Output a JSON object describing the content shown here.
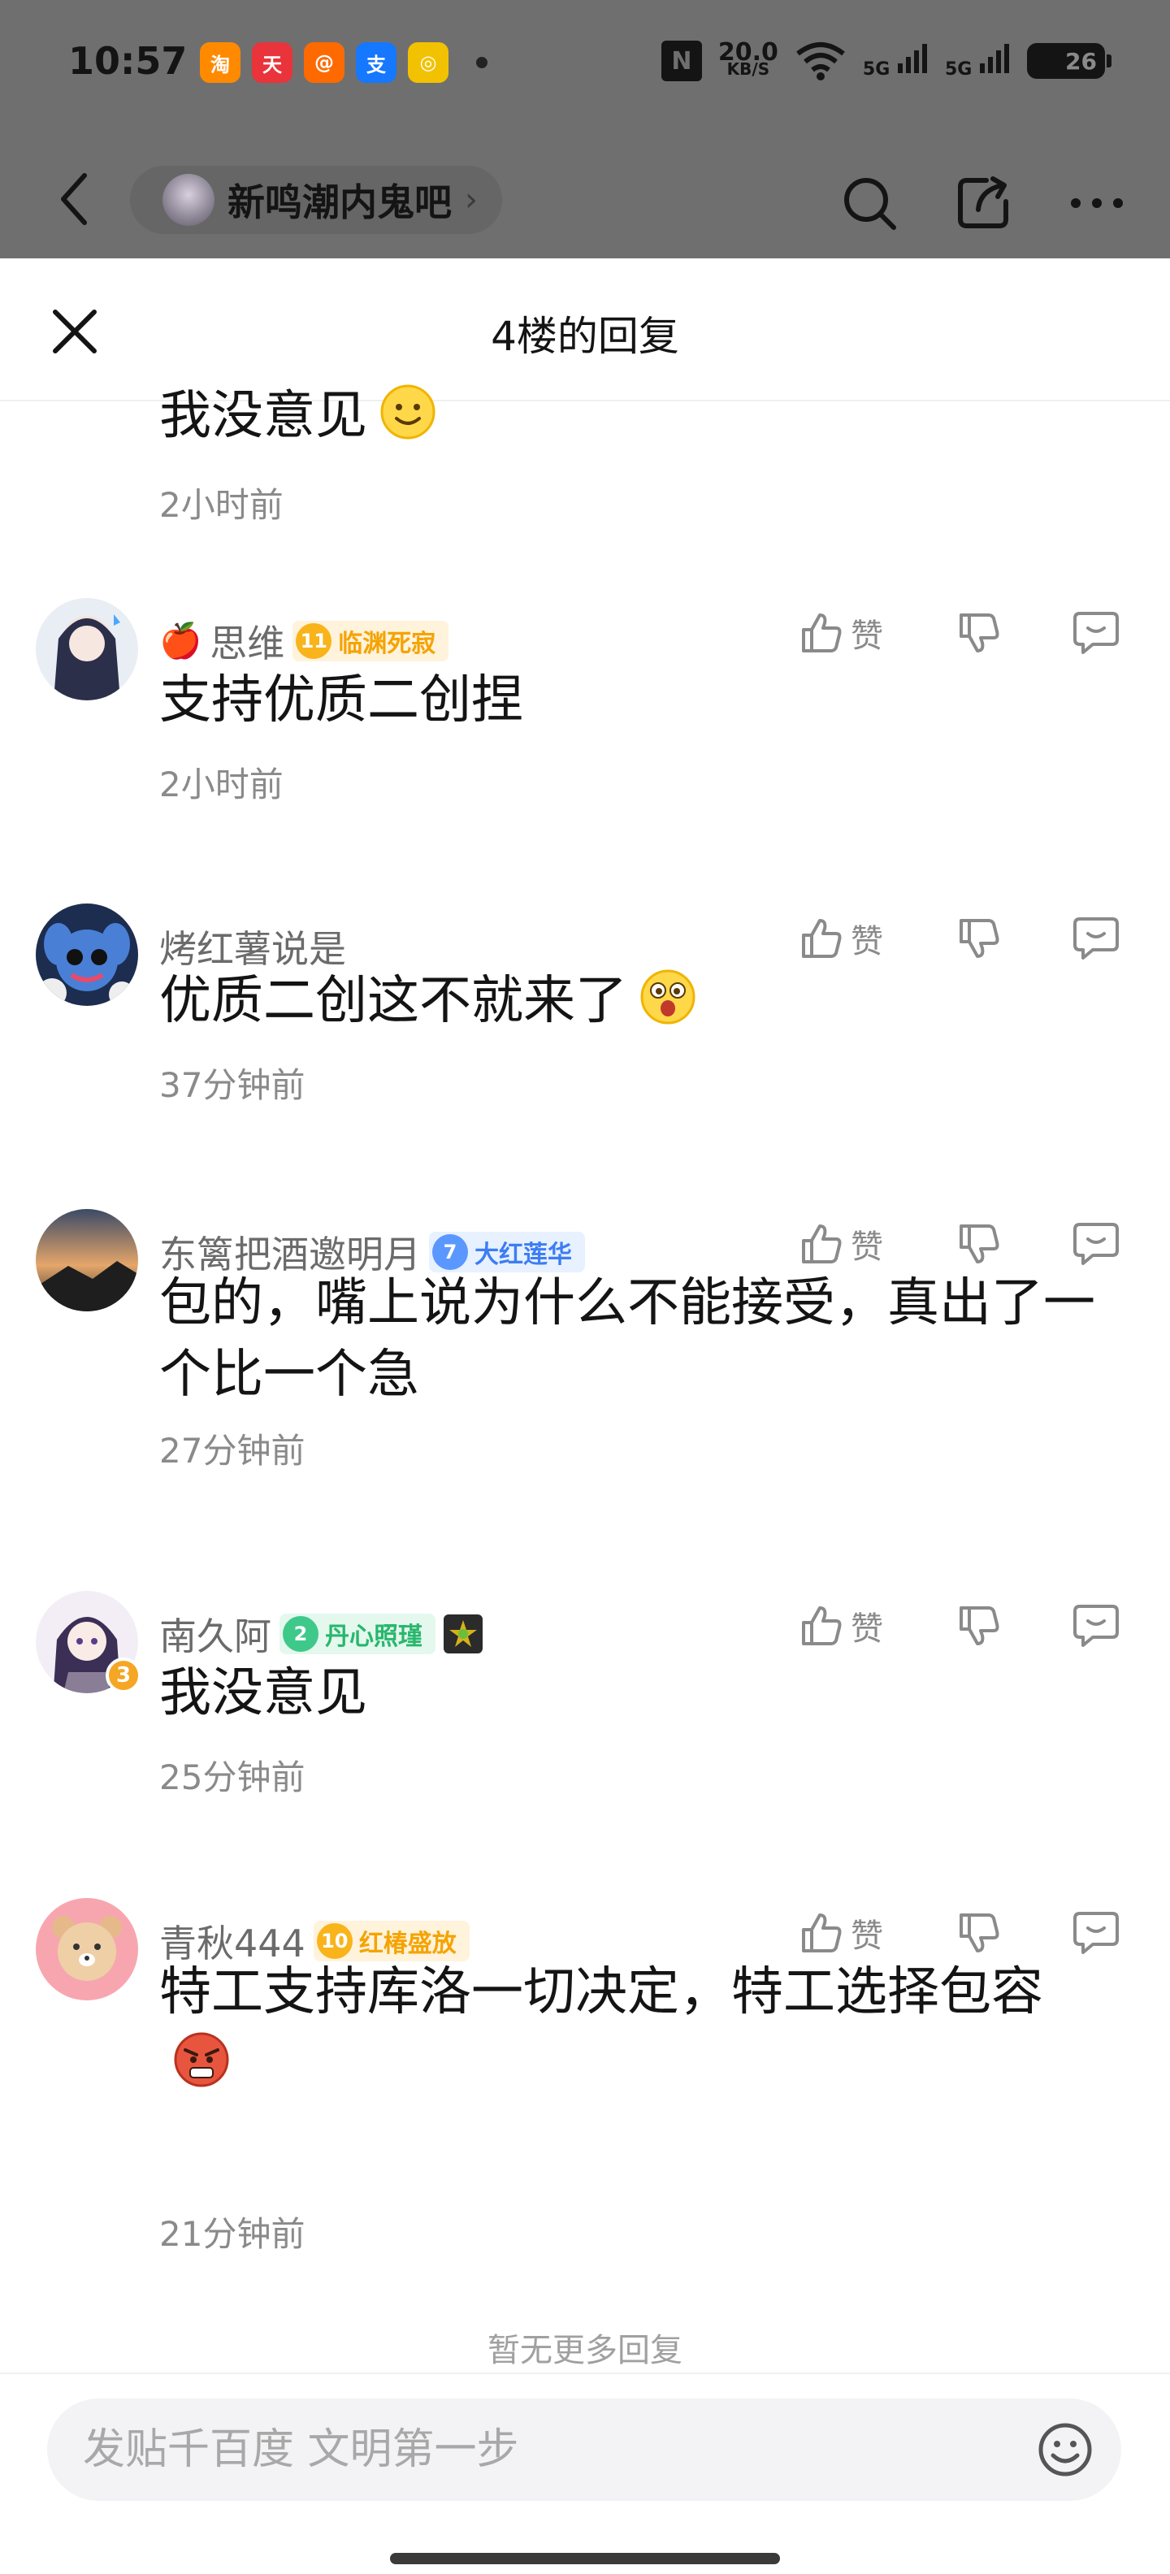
{
  "status_bar": {
    "time": "10:57",
    "net_speed_value": "20.0",
    "net_speed_unit": "KB/S",
    "signal_1": "5G",
    "signal_2": "5G",
    "battery": "26",
    "app_icons": [
      {
        "name": "taobao-app-icon",
        "glyph": "淘",
        "color": "#ff8a00"
      },
      {
        "name": "mall-app-icon",
        "glyph": "天",
        "color": "#e8343a"
      },
      {
        "name": "red-app-icon",
        "glyph": "@",
        "color": "#ff6a00"
      },
      {
        "name": "alipay-app-icon",
        "glyph": "支",
        "color": "#1677ff"
      },
      {
        "name": "yellow-app-icon",
        "glyph": "◎",
        "color": "#f2c200"
      }
    ]
  },
  "nav": {
    "forum_name": "新鸣潮内鬼吧",
    "chevron": "›"
  },
  "sheet": {
    "title": "4楼的回复"
  },
  "replies": [
    {
      "name": "",
      "text": "我没意见",
      "time": "2小时前"
    },
    {
      "name_emoji": "🍎",
      "name": "思维",
      "badge_level": "11",
      "badge_text": "临渊死寂",
      "text": "支持优质二创捏",
      "time": "2小时前",
      "like_label": "赞"
    },
    {
      "name": "烤红薯说是",
      "text": "优质二创这不就来了",
      "time": "37分钟前",
      "like_label": "赞"
    },
    {
      "name": "东篱把酒邀明月",
      "badge_level": "7",
      "badge_text": "大红莲华",
      "text": "包的，嘴上说为什么不能接受，真出了一个比一个急",
      "time": "27分钟前",
      "like_label": "赞"
    },
    {
      "name": "南久阿",
      "badge_level": "2",
      "badge_text": "丹心照瑾",
      "avatar_badge": "3",
      "text": "我没意见",
      "time": "25分钟前",
      "like_label": "赞"
    },
    {
      "name": "青秋444",
      "badge_level": "10",
      "badge_text": "红椿盛放",
      "text": "特工支持库洛一切决定，特工选择包容",
      "time": "21分钟前",
      "like_label": "赞"
    }
  ],
  "footer": {
    "no_more": "暂无更多回复",
    "input_placeholder": "发贴千百度 文明第一步"
  }
}
